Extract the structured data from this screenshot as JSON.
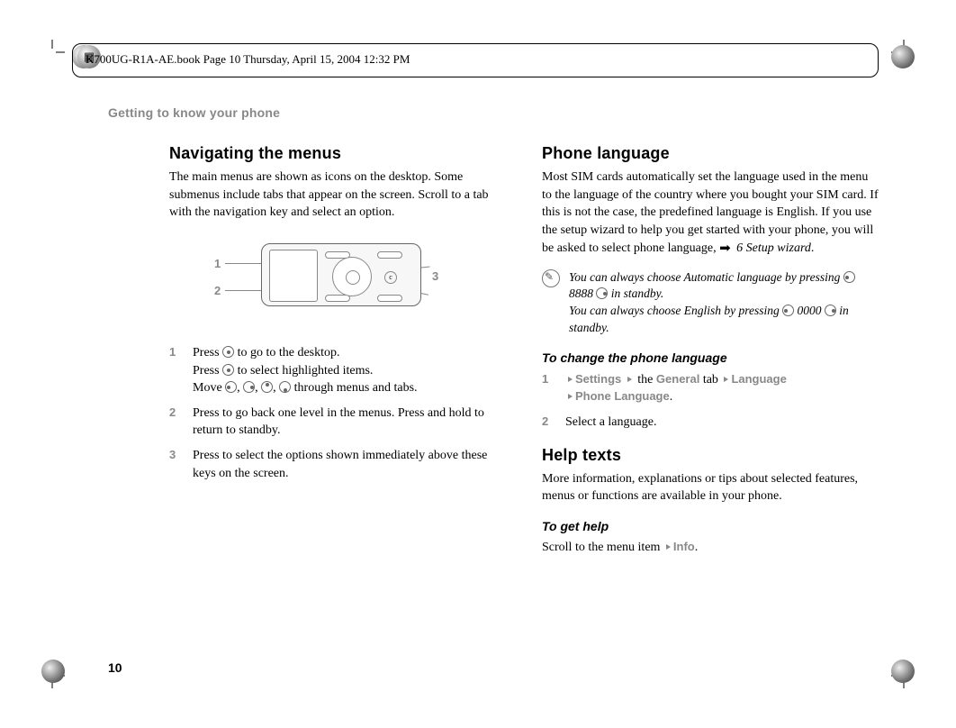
{
  "meta": {
    "doc_info": "K700UG-R1A-AE.book  Page 10  Thursday, April 15, 2004  12:32 PM",
    "section_label": "Getting to know your phone",
    "page_number": "10"
  },
  "left": {
    "heading": "Navigating the menus",
    "intro": "The main menus are shown as icons on the desktop. Some submenus include tabs that appear on the screen. Scroll to a tab with the navigation key and select an option.",
    "callouts": {
      "c1": "1",
      "c2": "2",
      "c3": "3"
    },
    "items": [
      {
        "n": "1",
        "line1a": "Press ",
        "line1b": " to go to the desktop.",
        "line2a": "Press ",
        "line2b": " to select highlighted items.",
        "line3a": "Move ",
        "line3b": " through menus and tabs."
      },
      {
        "n": "2",
        "line1": "Press to go back one level in the menus. Press and hold to return to standby."
      },
      {
        "n": "3",
        "line1": "Press to select the options shown immediately above these keys on the screen."
      }
    ]
  },
  "right": {
    "phone_lang_heading": "Phone language",
    "phone_lang_body_a": "Most SIM cards automatically set the language used in the menu to the language of the country where you bought your SIM card. If this is not the case, the predefined language is English. If you use the setup wizard to help you get started with your phone, you will be asked to select phone language, ",
    "phone_lang_ref": "6 Setup wizard",
    "tip1": "You can always choose Automatic language by pressing ",
    "tip1_code": " 8888 ",
    "tip1_end": " in standby.",
    "tip2": "You can always choose English by pressing ",
    "tip2_code": " 0000 ",
    "tip2_end": " in standby.",
    "change_heading": "To change the phone language",
    "change_step1_parts": {
      "settings": "Settings",
      "the": " the ",
      "general": "General",
      "tab": " tab ",
      "language": "Language",
      "phone_language": "Phone Language"
    },
    "change_step1_n": "1",
    "change_step2_n": "2",
    "change_step2": "Select a language.",
    "help_heading": "Help texts",
    "help_body": "More information, explanations or tips about selected features, menus or functions are available in your phone.",
    "get_help_heading": "To get help",
    "get_help_body_a": "Scroll to the menu item ",
    "get_help_info": "Info",
    "period": "."
  }
}
